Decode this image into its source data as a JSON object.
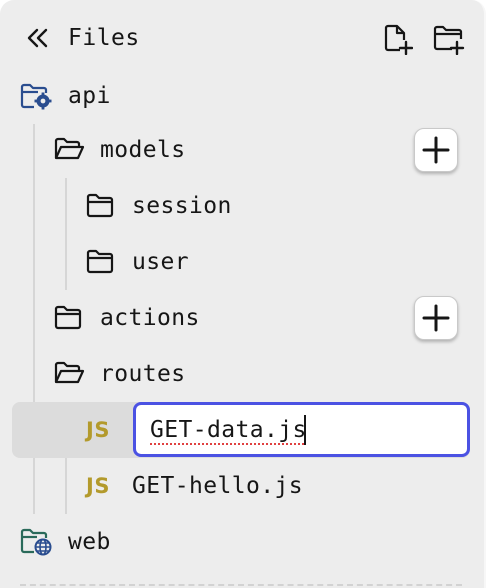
{
  "header": {
    "title": "Files",
    "collapse_icon": "double-chevron-left-icon",
    "new_file_icon": "file-plus-icon",
    "new_folder_icon": "folder-plus-icon"
  },
  "tree": {
    "api": {
      "label": "api",
      "icon": "folder-gear-icon"
    },
    "models": {
      "label": "models",
      "icon": "folder-open-icon"
    },
    "session": {
      "label": "session",
      "icon": "folder-icon"
    },
    "user": {
      "label": "user",
      "icon": "folder-icon"
    },
    "actions": {
      "label": "actions",
      "icon": "folder-icon"
    },
    "routes": {
      "label": "routes",
      "icon": "folder-open-icon"
    },
    "get_data": {
      "badge": "JS",
      "value": "GET-data.js"
    },
    "get_hello": {
      "badge": "JS",
      "label": "GET-hello.js"
    },
    "web": {
      "label": "web",
      "icon": "folder-globe-icon"
    }
  },
  "colors": {
    "panel_bg": "#ededed",
    "selected_bg": "#dcdcdc",
    "accent_focus": "#4b52e3",
    "js_badge": "#b39a2c",
    "special_folder": "#2a4d8f",
    "spellcheck": "#e04040"
  }
}
